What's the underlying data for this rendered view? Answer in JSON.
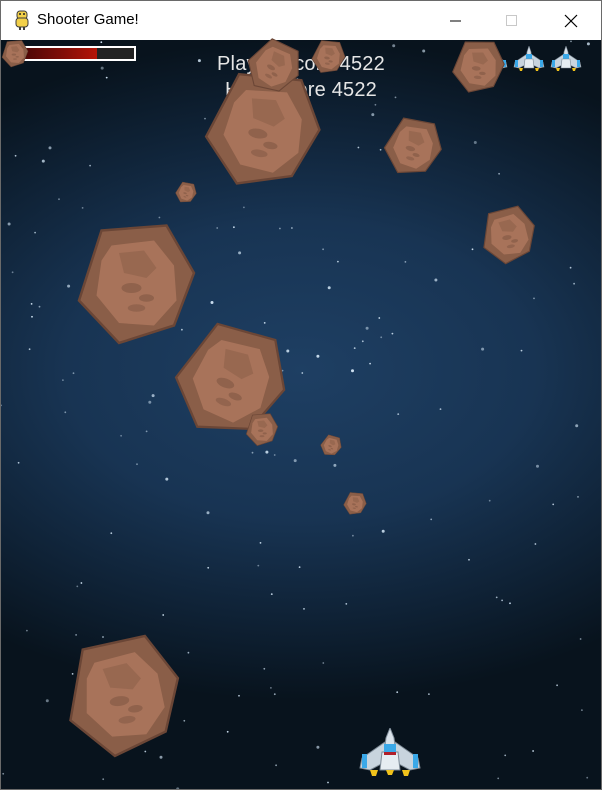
{
  "window": {
    "title": "Shooter Game!",
    "icon": "python-snake-icon",
    "controls": [
      "minimize-icon",
      "maximize-icon",
      "close-icon"
    ]
  },
  "hud": {
    "player_score_label": "Player Score 4522",
    "high_score_label": "High Score 4522",
    "player_score": 4522,
    "high_score": 4522,
    "health_fraction": 0.7,
    "lives": 3
  },
  "colors": {
    "space_mid": "#1e3f63",
    "space_edge": "#08131d",
    "asteroid_dark": "#8a5e48",
    "asteroid_light": "#a8735a",
    "health_fill": "#b51408",
    "ship_body": "#c8d4de",
    "ship_accent": "#3aa8e8"
  }
}
